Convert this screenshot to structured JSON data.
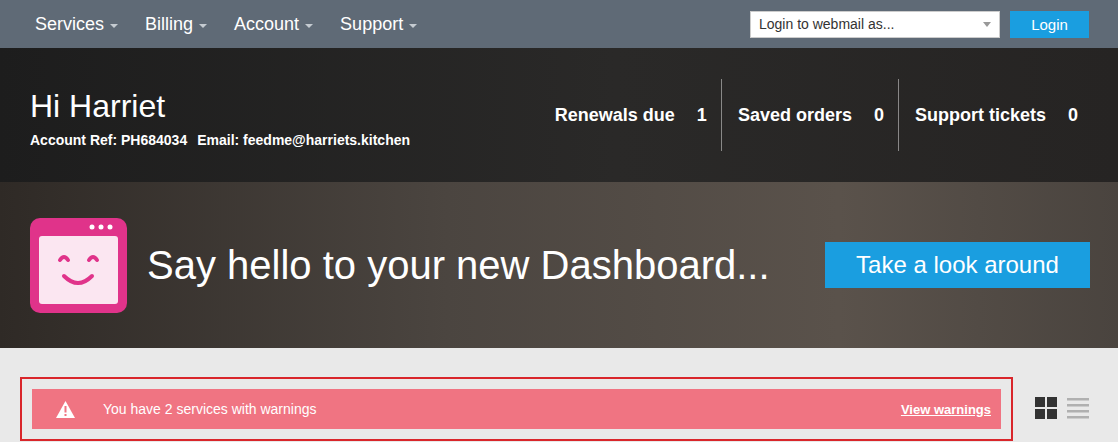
{
  "nav": {
    "items": [
      {
        "label": "Services"
      },
      {
        "label": "Billing"
      },
      {
        "label": "Account"
      },
      {
        "label": "Support"
      }
    ]
  },
  "webmail": {
    "placeholder": "Login to webmail as...",
    "button": "Login"
  },
  "header": {
    "greeting": "Hi Harriet",
    "ref_label": "Account Ref:",
    "ref": "PH684034",
    "email_label": "Email:",
    "email": "feedme@harriets.kitchen"
  },
  "stats": [
    {
      "label": "Renewals due",
      "count": "1"
    },
    {
      "label": "Saved orders",
      "count": "0"
    },
    {
      "label": "Support tickets",
      "count": "0"
    }
  ],
  "banner": {
    "title": "Say hello to your new Dashboard...",
    "button": "Take a look around"
  },
  "warning": {
    "message": "You have 2 services with warnings",
    "link": "View warnings",
    "highlighted": true
  },
  "view_modes": [
    {
      "kind": "grid",
      "selected": true
    },
    {
      "kind": "list",
      "selected": false
    }
  ]
}
